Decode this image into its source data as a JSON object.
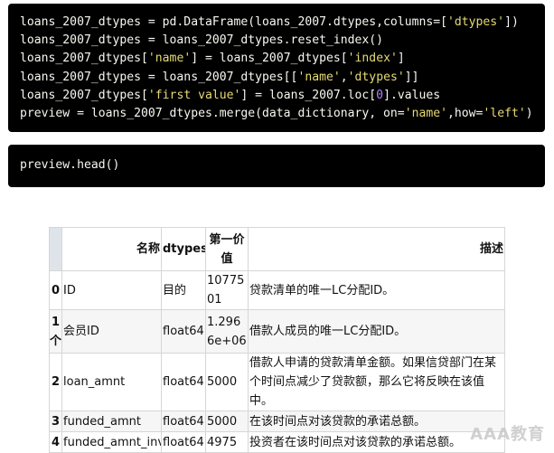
{
  "code_cell_1": {
    "lines": [
      [
        {
          "t": "loans_2007_dtypes = pd.DataFrame(loans_2007.dtypes,columns=["
        },
        {
          "t": "'dtypes'",
          "c": "str"
        },
        {
          "t": "])"
        }
      ],
      [
        {
          "t": "loans_2007_dtypes = loans_2007_dtypes.reset_index()"
        }
      ],
      [
        {
          "t": "loans_2007_dtypes["
        },
        {
          "t": "'name'",
          "c": "str"
        },
        {
          "t": "] = loans_2007_dtypes["
        },
        {
          "t": "'index'",
          "c": "str"
        },
        {
          "t": "]"
        }
      ],
      [
        {
          "t": "loans_2007_dtypes = loans_2007_dtypes[["
        },
        {
          "t": "'name'",
          "c": "str"
        },
        {
          "t": ","
        },
        {
          "t": "'dtypes'",
          "c": "str"
        },
        {
          "t": "]]"
        }
      ],
      [
        {
          "t": "loans_2007_dtypes["
        },
        {
          "t": "'first value'",
          "c": "str"
        },
        {
          "t": "] = loans_2007.loc["
        },
        {
          "t": "0",
          "c": "num"
        },
        {
          "t": "].values"
        }
      ],
      [
        {
          "t": "preview = loans_2007_dtypes.merge(data_dictionary, on="
        },
        {
          "t": "'name'",
          "c": "str"
        },
        {
          "t": ",how="
        },
        {
          "t": "'left'",
          "c": "str"
        },
        {
          "t": ")"
        }
      ]
    ]
  },
  "code_cell_2": {
    "lines": [
      [
        {
          "t": "preview.head()"
        }
      ]
    ]
  },
  "table": {
    "headers": {
      "index": "",
      "name": "名称",
      "dtypes": "dtypes",
      "first": "第一价值",
      "desc": "描述"
    },
    "rows": [
      {
        "idx": "0",
        "name": "ID",
        "dtypes": "目的",
        "first": "1077501",
        "desc": "贷款清单的唯一LC分配ID。"
      },
      {
        "idx": "1个",
        "name": "会员ID",
        "dtypes": "float64",
        "first": "1.2966e+06",
        "desc": "借款人成员的唯一LC分配ID。"
      },
      {
        "idx": "2",
        "name": "loan_amnt",
        "dtypes": "float64",
        "first": "5000",
        "desc": "借款人申请的贷款清单金额。如果信贷部门在某个时间点减少了贷款额，那么它将反映在该值中。"
      },
      {
        "idx": "3",
        "name": "funded_amnt",
        "dtypes": "float64",
        "first": "5000",
        "desc": "在该时间点对该贷款的承诺总额。"
      },
      {
        "idx": "4",
        "name": "funded_amnt_inv",
        "dtypes": "float64",
        "first": "4975",
        "desc": "投资者在该时间点对该贷款的承诺总额。"
      }
    ]
  },
  "watermark": "AAA教育"
}
